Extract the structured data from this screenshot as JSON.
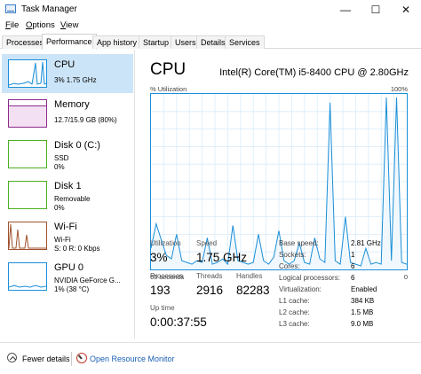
{
  "window": {
    "title": "Task Manager",
    "controls": {
      "minimize": "—",
      "maximize": "☐",
      "close": "✕"
    }
  },
  "menu": {
    "items": [
      {
        "u": "F",
        "rest": "ile"
      },
      {
        "u": "O",
        "rest": "ptions"
      },
      {
        "u": "V",
        "rest": "iew"
      }
    ]
  },
  "tabs": [
    {
      "label": "Processes",
      "active": false
    },
    {
      "label": "Performance",
      "active": true
    },
    {
      "label": "App history",
      "active": false
    },
    {
      "label": "Startup",
      "active": false
    },
    {
      "label": "Users",
      "active": false
    },
    {
      "label": "Details",
      "active": false
    },
    {
      "label": "Services",
      "active": false
    }
  ],
  "sidebar": {
    "items": [
      {
        "title": "CPU",
        "sub1": "3%  1.75 GHz",
        "sub2": "",
        "color": "#1a8fd8",
        "icon": "cpu-graph-icon",
        "active": true
      },
      {
        "title": "Memory",
        "sub1": "12.7/15.9 GB (80%)",
        "sub2": "",
        "color": "#8b2c8b",
        "icon": "memory-graph-icon",
        "active": false
      },
      {
        "title": "Disk 0 (C:)",
        "sub1": "SSD",
        "sub2": "0%",
        "color": "#4caf20",
        "icon": "disk-graph-icon",
        "active": false
      },
      {
        "title": "Disk 1",
        "sub1": "Removable",
        "sub2": "0%",
        "color": "#4caf20",
        "icon": "disk-graph-icon",
        "active": false
      },
      {
        "title": "Wi-Fi",
        "sub1": "Wi-Fi",
        "sub2": "S: 0  R: 0 Kbps",
        "color": "#a0522d",
        "icon": "wifi-graph-icon",
        "active": false
      },
      {
        "title": "GPU 0",
        "sub1": "NVIDIA GeForce G...",
        "sub2": "1%  (38 °C)",
        "color": "#1a8fd8",
        "icon": "gpu-graph-icon",
        "active": false
      }
    ]
  },
  "main": {
    "title": "CPU",
    "model": "Intel(R) Core(TM) i5-8400 CPU @ 2.80GHz",
    "chart_top_left": "% Utilization",
    "chart_top_right": "100%",
    "chart_bottom_left": "60 seconds",
    "chart_bottom_right": "0",
    "stats": {
      "utilization_label": "Utilization",
      "utilization": "3%",
      "speed_label": "Speed",
      "speed": "1.75 GHz",
      "processes_label": "Processes",
      "processes": "193",
      "threads_label": "Threads",
      "threads": "2916",
      "handles_label": "Handles",
      "handles": "82283",
      "uptime_label": "Up time",
      "uptime": "0:00:37:55"
    },
    "specs": [
      {
        "k": "Base speed:",
        "v": "2.81 GHz"
      },
      {
        "k": "Sockets:",
        "v": "1"
      },
      {
        "k": "Cores:",
        "v": "6"
      },
      {
        "k": "Logical processors:",
        "v": "6"
      },
      {
        "k": "Virtualization:",
        "v": "Enabled"
      },
      {
        "k": "L1 cache:",
        "v": "384 KB"
      },
      {
        "k": "L2 cache:",
        "v": "1.5 MB"
      },
      {
        "k": "L3 cache:",
        "v": "9.0 MB"
      }
    ]
  },
  "footer": {
    "fewer_details": "Fewer details",
    "open_resource_monitor": "Open Resource Monitor"
  },
  "colors": {
    "cpu_line": "#1a8fd8",
    "cpu_fill": "#f1f8fd",
    "grid": "#d8ecf9",
    "selected": "#cce4f7"
  },
  "chart_data": {
    "type": "area",
    "title": "% Utilization",
    "ylim": [
      0,
      100
    ],
    "x_range_seconds": 60,
    "values": [
      12,
      26,
      17,
      8,
      6,
      20,
      5,
      4,
      3,
      5,
      4,
      18,
      3,
      4,
      6,
      3,
      25,
      5,
      4,
      3,
      4,
      20,
      5,
      3,
      7,
      22,
      5,
      3,
      5,
      15,
      4,
      3,
      18,
      6,
      4,
      95,
      5,
      3,
      30,
      4,
      3,
      2,
      12,
      3,
      4,
      3,
      98,
      5,
      98,
      4,
      3
    ]
  }
}
